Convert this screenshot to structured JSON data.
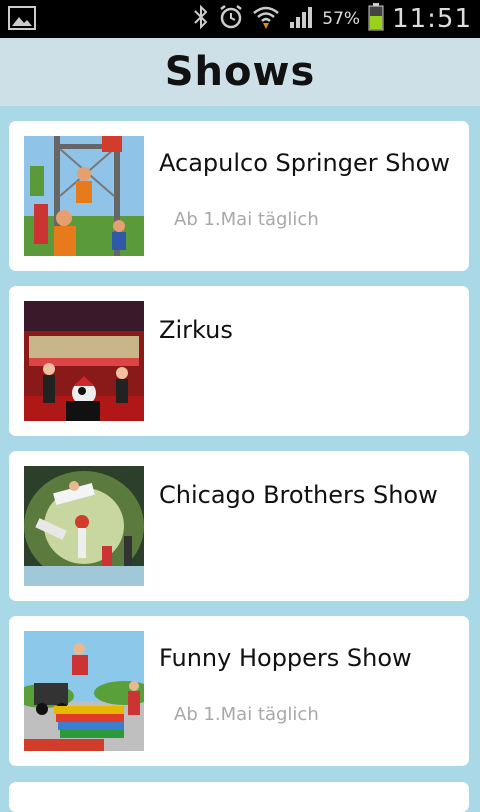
{
  "status_bar": {
    "battery_percent": "57%",
    "time": "11:51",
    "icons": [
      "gallery-icon",
      "bluetooth-icon",
      "alarm-icon",
      "wifi-icon",
      "signal-icon",
      "battery-icon"
    ]
  },
  "header": {
    "title": "Shows"
  },
  "shows": [
    {
      "title": "Acapulco Springer Show",
      "subtitle": "Ab 1.Mai täglich"
    },
    {
      "title": "Zirkus",
      "subtitle": ""
    },
    {
      "title": "Chicago Brothers Show",
      "subtitle": ""
    },
    {
      "title": "Funny Hoppers Show",
      "subtitle": "Ab 1.Mai täglich"
    }
  ],
  "colors": {
    "background": "#a9d8e6",
    "header": "#cde0e8",
    "card": "#ffffff",
    "subtitle": "#a8a8a8"
  }
}
